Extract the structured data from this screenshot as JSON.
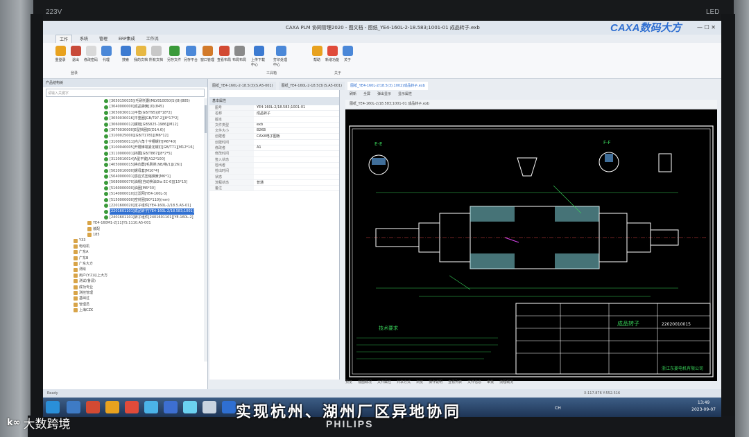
{
  "monitor": {
    "model": "223V",
    "led": "LED",
    "brand": "PHILIPS"
  },
  "window": {
    "title": "CAXA PLM 协同管理2020 - 图文档 - 图纸_YE4-160L-2-18.583;1001-01 成品转子.exb",
    "logo": "CAXA数码大方"
  },
  "ribbon": {
    "tabs": [
      "工作",
      "系统",
      "管理",
      "ERP集成",
      "工作流"
    ],
    "buttons": [
      "重登录",
      "退出",
      "修改密码",
      "代理",
      "搜索",
      "我的文档",
      "所有文档",
      "另存文件",
      "另存平台",
      "窗口管理",
      "查看布局",
      "布局布局",
      "上传下载中心",
      "打印处理中心",
      "帮助",
      "新增功能",
      "关于"
    ],
    "groups": [
      "登录",
      "工具箱",
      "关于"
    ]
  },
  "left_panel": {
    "header": "产品结构树",
    "search_placeholder": "请输入关键字",
    "tree": [
      "[3050150035](毛刷托翻)MLY810050(S)(8)(885)",
      "[3040000000]成品弹簧[(0)(845)",
      "[3050030011]平垫(GB/T95)[8*18*2]",
      "[3050030016]平垫圈[GB/T97.2][8*17*2]",
      "[3060000012]螺栓[GB5825-1986][M12]",
      "[3070030000]E型挡圈[E(D14.6)]",
      "[3100025000][GB/T1781][M6*12]",
      "[3100050011]内六角十字槽螺钉[M6*40]",
      "[3100040005]开槽锥端紧定螺钉[GB/T71][M12*16]",
      "[3110000001]挡圈[GB/T867][8*2*5]",
      "[3120010014]A型平键[A12*100]",
      "[4050000015]换向器[毛刷类,NB/绝/1][(26)]",
      "[5020010000]螺母套[M10*4]",
      "[5040000001]感应式压缩弹簧[M6*1]",
      "[5080000070]油帽[自动换油Dia EC-6]][15*15]",
      "[5160000000]油圈[M6*30]",
      "[5140000010]过滤网[YE4-160L-3]",
      "[5150000000]密封圈[90*110](mm)",
      "[2201600020]定子组件[YE4-160L-2/18.5.A5-01]",
      "[2201601101]成品转子[YE4-160L-2/18.583;1001]",
      "[2401601101]转子组件[2401601101][YE-160L-2]",
      "YE4-160M1-2[11]YS.1110.A5-001",
      "装配",
      "185",
      "Y33",
      "电动机",
      "广东A",
      "广东B",
      "广东大方",
      "测绘",
      "用户(Y:2)以上大方",
      "测试(鲁源)",
      "成功专业",
      "测控管理",
      "基础过",
      "管理员",
      "上海CZK"
    ],
    "selected_index": 19,
    "footer_tabs": [
      "工作流程",
      "产品结构树",
      "文件管理"
    ]
  },
  "doc_tabs": [
    "图纸_YE4-160L-2-18.5(3)(S.A5-001)",
    "图纸_YE4-160L-2-18.5(3)(S.A5-001)",
    "图纸_YE4-160L-2/18.5(3).1002)成品转子.exb"
  ],
  "viewer_toolbar": [
    "刷新",
    "全屏",
    "弹出显示",
    "显示属性"
  ],
  "viewer_subtab": "图纸_YE4-160L-2/18.583;1001-01 成品转子.exb",
  "properties": {
    "section": "基本属性",
    "rows": [
      {
        "k": "图号",
        "v": "YE4-160L-2/18.583;1001-01"
      },
      {
        "k": "名称",
        "v": "成品转子"
      },
      {
        "k": "版本",
        "v": ""
      },
      {
        "k": "文件类型",
        "v": "exb"
      },
      {
        "k": "文件大小",
        "v": "82KB"
      },
      {
        "k": "创建者",
        "v": "CAXA电子图板"
      },
      {
        "k": "创建时间",
        "v": ""
      },
      {
        "k": "修改者",
        "v": "A1"
      },
      {
        "k": "修改时间",
        "v": ""
      },
      {
        "k": "签入状态",
        "v": ""
      },
      {
        "k": "检出者",
        "v": ""
      },
      {
        "k": "检出时间",
        "v": ""
      },
      {
        "k": "状态",
        "v": ""
      },
      {
        "k": "流程状态",
        "v": "普通"
      },
      {
        "k": "备注",
        "v": ""
      }
    ]
  },
  "drawing": {
    "title_block": {
      "part_name": "成品转子",
      "drawing_no": "22020010015",
      "company": "浙江东菱电机有限公司"
    },
    "tech_requirements_title": "技术要求",
    "section_labels": [
      "E-E",
      "F-F"
    ]
  },
  "bottom_tabs": [
    "预览",
    "视图概况",
    "文件属性",
    "共享方式",
    "浏览",
    "操作说明",
    "查看列表",
    "文件信息",
    "审批",
    "流程概况"
  ],
  "status": {
    "left": "Ready",
    "coords": "X:117.876  Y:552.516",
    "user": "当前用户：李迎辉"
  },
  "taskbar": {
    "time": "13:49",
    "date": "2023-09-07",
    "lang": "CH"
  },
  "subtitle": "实现杭州、湖州厂区异地协同",
  "watermark": "大数跨境",
  "colors": {
    "accent": "#2f6fd1",
    "drawing_lines": "#ffffff",
    "dimension": "#39d35a",
    "highlight": "#7fd2d8"
  }
}
